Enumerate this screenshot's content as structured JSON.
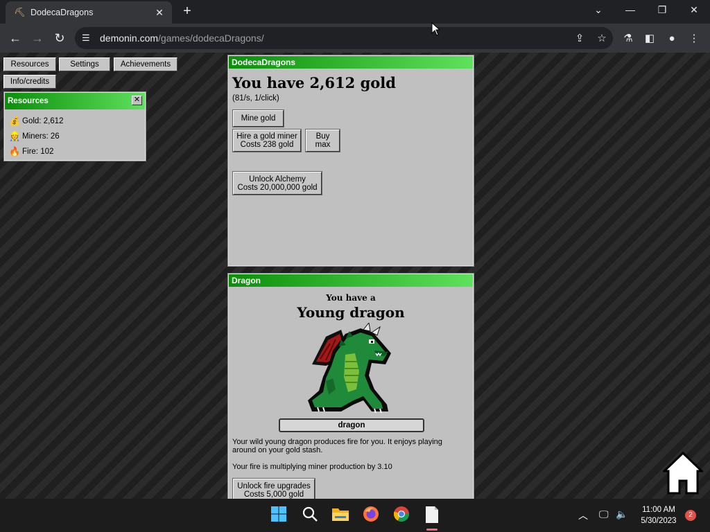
{
  "browser": {
    "tab_title": "DodecaDragons",
    "url_domain": "demonin.com",
    "url_path": "/games/dodecaDragons/"
  },
  "menu": {
    "resources": "Resources",
    "settings": "Settings",
    "achievements": "Achievements",
    "info": "Info/credits"
  },
  "resources_window": {
    "title": "Resources",
    "close": "✕",
    "gold": "Gold: 2,612",
    "miners": "Miners: 26",
    "fire": "Fire: 102"
  },
  "main_window": {
    "title": "DodecaDragons",
    "gold_text": "You have 2,612 gold",
    "rate_text": "(81/s, 1/click)",
    "mine_button": "Mine gold",
    "hire_line1": "Hire a gold miner",
    "hire_line2": "Costs 238 gold",
    "buy_line1": "Buy",
    "buy_line2": "max",
    "alchemy_line1": "Unlock Alchemy",
    "alchemy_line2": "Costs 20,000,000 gold"
  },
  "dragon_window": {
    "title": "Dragon",
    "you_have": "You have a",
    "stage": "Young dragon",
    "name": "dragon",
    "desc": "Your wild young dragon produces fire for you. It enjoys playing around on your gold stash.",
    "multiplier": "Your fire is multiplying miner production by 3.10",
    "fire_upg_line1": "Unlock fire upgrades",
    "fire_upg_line2": "Costs 5,000 gold"
  },
  "taskbar": {
    "time": "11:00 AM",
    "date": "5/30/2023",
    "notifications": "2"
  },
  "colors": {
    "title_green_dark": "#0b8f0b",
    "title_green_light": "#5ee25e",
    "panel_gray": "#c0c0c0",
    "dragon_green": "#1f8a3a",
    "dragon_wing": "#a01818"
  }
}
